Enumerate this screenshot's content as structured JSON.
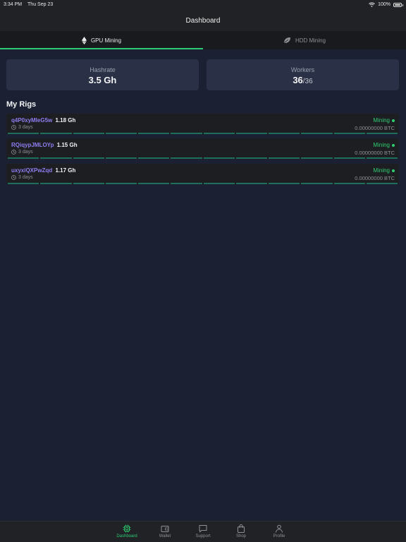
{
  "status_bar": {
    "time": "3:34 PM",
    "date": "Thu Sep 23",
    "battery": "100%"
  },
  "nav": {
    "title": "Dashboard"
  },
  "tabs": [
    {
      "label": "GPU Mining",
      "icon": "ethereum-icon",
      "active": true
    },
    {
      "label": "HDD Mining",
      "icon": "leaf-icon",
      "active": false
    }
  ],
  "stats": {
    "hashrate": {
      "label": "Hashrate",
      "value": "3.5 Gh"
    },
    "workers": {
      "label": "Workers",
      "value": "36",
      "total": "/36"
    }
  },
  "section_title": "My Rigs",
  "rigs": [
    {
      "name": "q4P0xyMIeG5w",
      "hashrate": "1.18 Gh",
      "uptime": "3 days",
      "status": "Mining",
      "earnings": "0.00000000 BTC"
    },
    {
      "name": "RQiqypJMLOYp",
      "hashrate": "1.15 Gh",
      "uptime": "3 days",
      "status": "Mining",
      "earnings": "0.00000000 BTC"
    },
    {
      "name": "uxyxiQXPwZqd",
      "hashrate": "1.17 Gh",
      "uptime": "3 days",
      "status": "Mining",
      "earnings": "0.00000000 BTC"
    }
  ],
  "tab_bar": [
    {
      "label": "Dashboard",
      "icon": "chip-icon",
      "active": true
    },
    {
      "label": "Wallet",
      "icon": "wallet-icon",
      "active": false
    },
    {
      "label": "Support",
      "icon": "chat-bubble-icon",
      "active": false
    },
    {
      "label": "Shop",
      "icon": "shopping-bag-icon",
      "active": false
    },
    {
      "label": "Profile",
      "icon": "person-icon",
      "active": false
    }
  ],
  "colors": {
    "accent": "#2ecc71",
    "rig_name": "#8f7df0",
    "background": "#1b2033",
    "card": "#2a3045"
  }
}
